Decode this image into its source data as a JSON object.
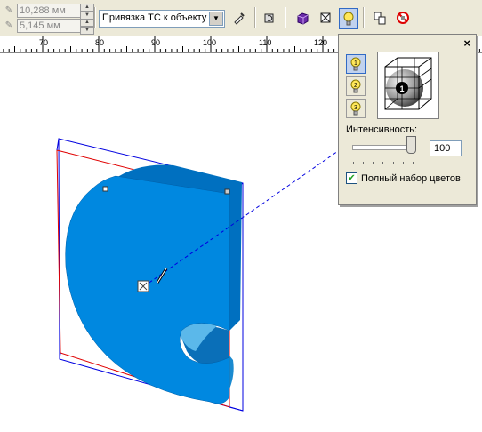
{
  "toolbar": {
    "x_value": "10,288 мм",
    "y_value": "5,145 мм",
    "snap_select": "Привязка ТС к объекту",
    "icons": [
      "ruler-x-icon",
      "ruler-y-icon",
      "lock-ratio-icon",
      "camera-icon",
      "vanishing-point-icon",
      "extrude-depth-icon",
      "color-cube-icon",
      "bevel-icon",
      "lighting-icon",
      "copy-extrude-icon",
      "clear-extrude-icon"
    ]
  },
  "ruler": {
    "labels": [
      "70",
      "80",
      "90",
      "100",
      "110",
      "120"
    ]
  },
  "lighting_panel": {
    "close": "×",
    "lights": [
      "1",
      "2",
      "3"
    ],
    "preview_light_label": "1",
    "intensity_label": "Интенсивность:",
    "intensity_value": "100",
    "intensity_level": 100,
    "full_color_label": "Полный набор цветов",
    "full_color_checked": true
  },
  "colors": {
    "object_face": "#0088e0",
    "object_side": "#0070c0",
    "bbox_red": "#e00000",
    "bbox_blue": "#0000e0",
    "toolbar_bg": "#ece9d8"
  }
}
